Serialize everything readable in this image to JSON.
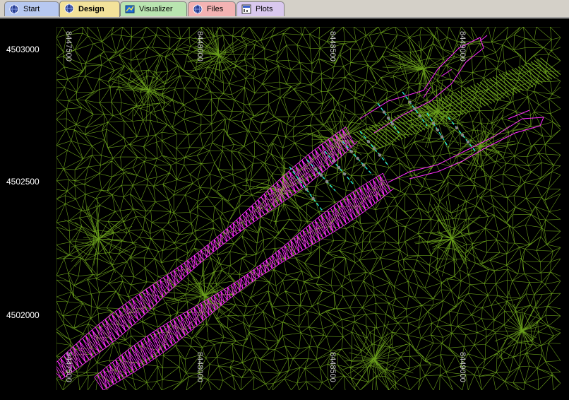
{
  "tabs": [
    {
      "label": "Start",
      "color": "#b7c8f0",
      "icon": "globe-icon"
    },
    {
      "label": "Design",
      "color": "#f3e29a",
      "icon": "globe-icon"
    },
    {
      "label": "Visualizer",
      "color": "#b9e4b0",
      "icon": "visualizer-icon"
    },
    {
      "label": "Files",
      "color": "#f3b3b3",
      "icon": "globe-icon"
    },
    {
      "label": "Plots",
      "color": "#d9c8ee",
      "icon": "plots-icon"
    }
  ],
  "active_tab": "Design",
  "y_axis": {
    "labels": [
      "4503000",
      "4502500",
      "4502000"
    ]
  },
  "x_axis": {
    "top_labels": [
      "8447500",
      "8448000",
      "8448500",
      "8449000"
    ],
    "bottom_labels": [
      "8447500",
      "8448000",
      "8448500",
      "8449000"
    ]
  },
  "colors": {
    "mesh": "#6a9f1b",
    "channel": "#ff2cff",
    "background": "#000000",
    "sections": "#29e8d0"
  }
}
